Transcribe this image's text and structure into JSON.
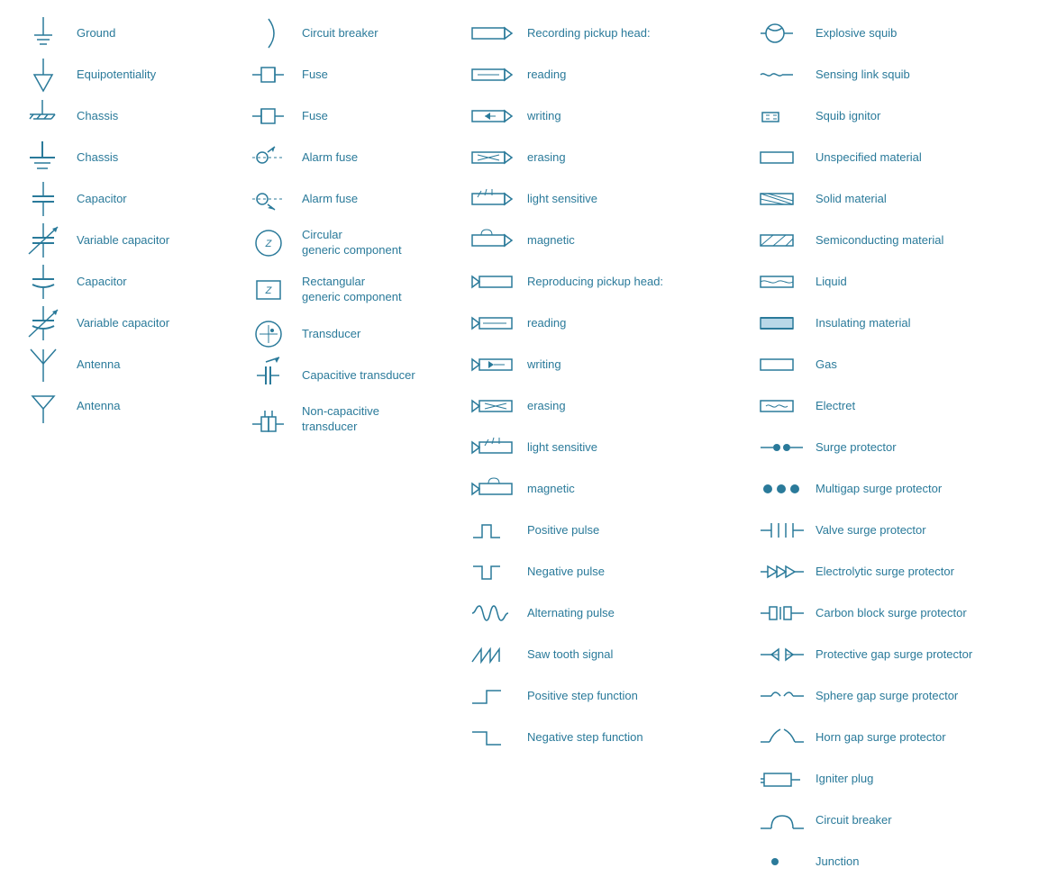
{
  "col1": [
    {
      "label": "Ground",
      "sym": "ground"
    },
    {
      "label": "Equipotentiality",
      "sym": "equipotentiality"
    },
    {
      "label": "Chassis",
      "sym": "chassis1"
    },
    {
      "label": "Chassis",
      "sym": "chassis2"
    },
    {
      "label": "Capacitor",
      "sym": "capacitor"
    },
    {
      "label": "Variable capacitor",
      "sym": "variable-capacitor"
    },
    {
      "label": "Capacitor",
      "sym": "capacitor2"
    },
    {
      "label": "Variable capacitor",
      "sym": "variable-capacitor2"
    },
    {
      "label": "Antenna",
      "sym": "antenna1"
    },
    {
      "label": "Antenna",
      "sym": "antenna2"
    }
  ],
  "col2": [
    {
      "label": "Circuit breaker",
      "sym": "circuit-breaker"
    },
    {
      "label": "Fuse",
      "sym": "fuse1"
    },
    {
      "label": "Fuse",
      "sym": "fuse2"
    },
    {
      "label": "Alarm fuse",
      "sym": "alarm-fuse1"
    },
    {
      "label": "Alarm fuse",
      "sym": "alarm-fuse2"
    },
    {
      "label": "Circular\ngeneric component",
      "sym": "circular-generic"
    },
    {
      "label": "Rectangular\ngeneric component",
      "sym": "rect-generic"
    },
    {
      "label": "Transducer",
      "sym": "transducer"
    },
    {
      "label": "Capacitive transducer",
      "sym": "cap-transducer"
    },
    {
      "label": "Non-capacitive\ntransducer",
      "sym": "non-cap-transducer"
    }
  ],
  "col3": [
    {
      "label": "Recording pickup head:",
      "sym": "pickup-head",
      "header": true
    },
    {
      "label": "reading",
      "sym": "reading1"
    },
    {
      "label": "writing",
      "sym": "writing1"
    },
    {
      "label": "erasing",
      "sym": "erasing1"
    },
    {
      "label": "light sensitive",
      "sym": "light-sensitive1"
    },
    {
      "label": "magnetic",
      "sym": "magnetic1"
    },
    {
      "label": "Reproducing pickup head:",
      "sym": "repro-head",
      "header": true
    },
    {
      "label": "reading",
      "sym": "reading2"
    },
    {
      "label": "writing",
      "sym": "writing2"
    },
    {
      "label": "erasing",
      "sym": "erasing2"
    },
    {
      "label": "light sensitive",
      "sym": "light-sensitive2"
    },
    {
      "label": "magnetic",
      "sym": "magnetic2"
    },
    {
      "label": "Positive pulse",
      "sym": "pos-pulse"
    },
    {
      "label": "Negative pulse",
      "sym": "neg-pulse"
    },
    {
      "label": "Alternating pulse",
      "sym": "alt-pulse"
    },
    {
      "label": "Saw tooth signal",
      "sym": "saw-tooth"
    },
    {
      "label": "Positive step function",
      "sym": "pos-step"
    },
    {
      "label": "Negative step function",
      "sym": "neg-step"
    }
  ],
  "col4": [
    {
      "label": "Explosive squib",
      "sym": "exp-squib"
    },
    {
      "label": "Sensing link squib",
      "sym": "sense-squib"
    },
    {
      "label": "Squib ignitor",
      "sym": "squib-ignitor"
    },
    {
      "label": "Unspecified material",
      "sym": "unspec-material"
    },
    {
      "label": "Solid material",
      "sym": "solid-material"
    },
    {
      "label": "Semiconducting material",
      "sym": "semi-material"
    },
    {
      "label": "Liquid",
      "sym": "liquid"
    },
    {
      "label": "Insulating material",
      "sym": "insulating"
    },
    {
      "label": "Gas",
      "sym": "gas"
    },
    {
      "label": "Electret",
      "sym": "electret"
    },
    {
      "label": "Surge protector",
      "sym": "surge-prot"
    },
    {
      "label": "Multigap surge protector",
      "sym": "multigap"
    },
    {
      "label": "Valve surge protector",
      "sym": "valve-surge"
    },
    {
      "label": "Electrolytic surge protector",
      "sym": "electro-surge"
    },
    {
      "label": "Carbon block surge protector",
      "sym": "carbon-surge"
    },
    {
      "label": "Protective gap surge protector",
      "sym": "prot-gap"
    },
    {
      "label": "Sphere gap surge protector",
      "sym": "sphere-gap"
    },
    {
      "label": "Horn gap surge protector",
      "sym": "horn-gap"
    },
    {
      "label": "Igniter plug",
      "sym": "igniter-plug"
    },
    {
      "label": "Circuit breaker",
      "sym": "circuit-breaker2"
    },
    {
      "label": "Junction",
      "sym": "junction"
    }
  ]
}
